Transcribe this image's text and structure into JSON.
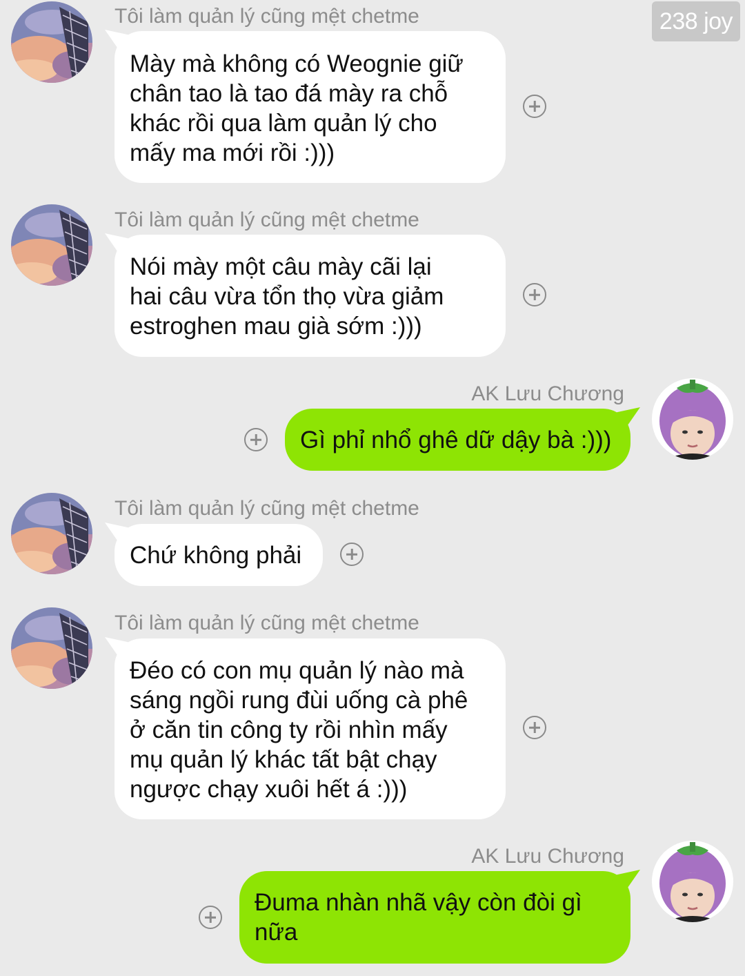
{
  "watermark": "238 joy",
  "contacts": {
    "other": {
      "name": "Tôi làm quản lý cũng mệt chetme",
      "avatar_icon": "sky-fire-escape-avatar"
    },
    "self": {
      "name": "AK Lưu Chương",
      "avatar_icon": "eggplant-hat-avatar"
    }
  },
  "colors": {
    "background": "#eaeaea",
    "incoming_bubble": "#ffffff",
    "outgoing_bubble": "#8ee404",
    "sender_name": "#8c8c8c"
  },
  "messages": [
    {
      "direction": "incoming",
      "sender": "Tôi làm quản lý cũng mệt chetme",
      "text": "Mày mà không có Weognie giữ\nchân tao là tao đá mày ra chỗ\nkhác rồi qua làm quản lý cho\nmấy ma mới rồi :)))"
    },
    {
      "direction": "incoming",
      "sender": "Tôi làm quản lý cũng mệt chetme",
      "text": "Nói mày một câu mày cãi lại\nhai câu vừa tổn thọ vừa giảm\nestroghen mau già sớm :)))"
    },
    {
      "direction": "outgoing",
      "sender": "AK Lưu Chương",
      "text": "Gì phỉ nhổ ghê dữ dậy bà :)))"
    },
    {
      "direction": "incoming",
      "sender": "Tôi làm quản lý cũng mệt chetme",
      "text": "Chứ không phải"
    },
    {
      "direction": "incoming",
      "sender": "Tôi làm quản lý cũng mệt chetme",
      "text": "Đéo có con mụ quản lý nào mà\nsáng ngồi rung đùi uống cà phê\nở căn tin công ty rồi nhìn mấy\nmụ quản lý khác tất bật chạy\nngược chạy xuôi hết á :)))"
    },
    {
      "direction": "outgoing",
      "sender": "AK Lưu Chương",
      "text": "Đuma nhàn nhã vậy còn đòi gì\nnữa"
    }
  ]
}
